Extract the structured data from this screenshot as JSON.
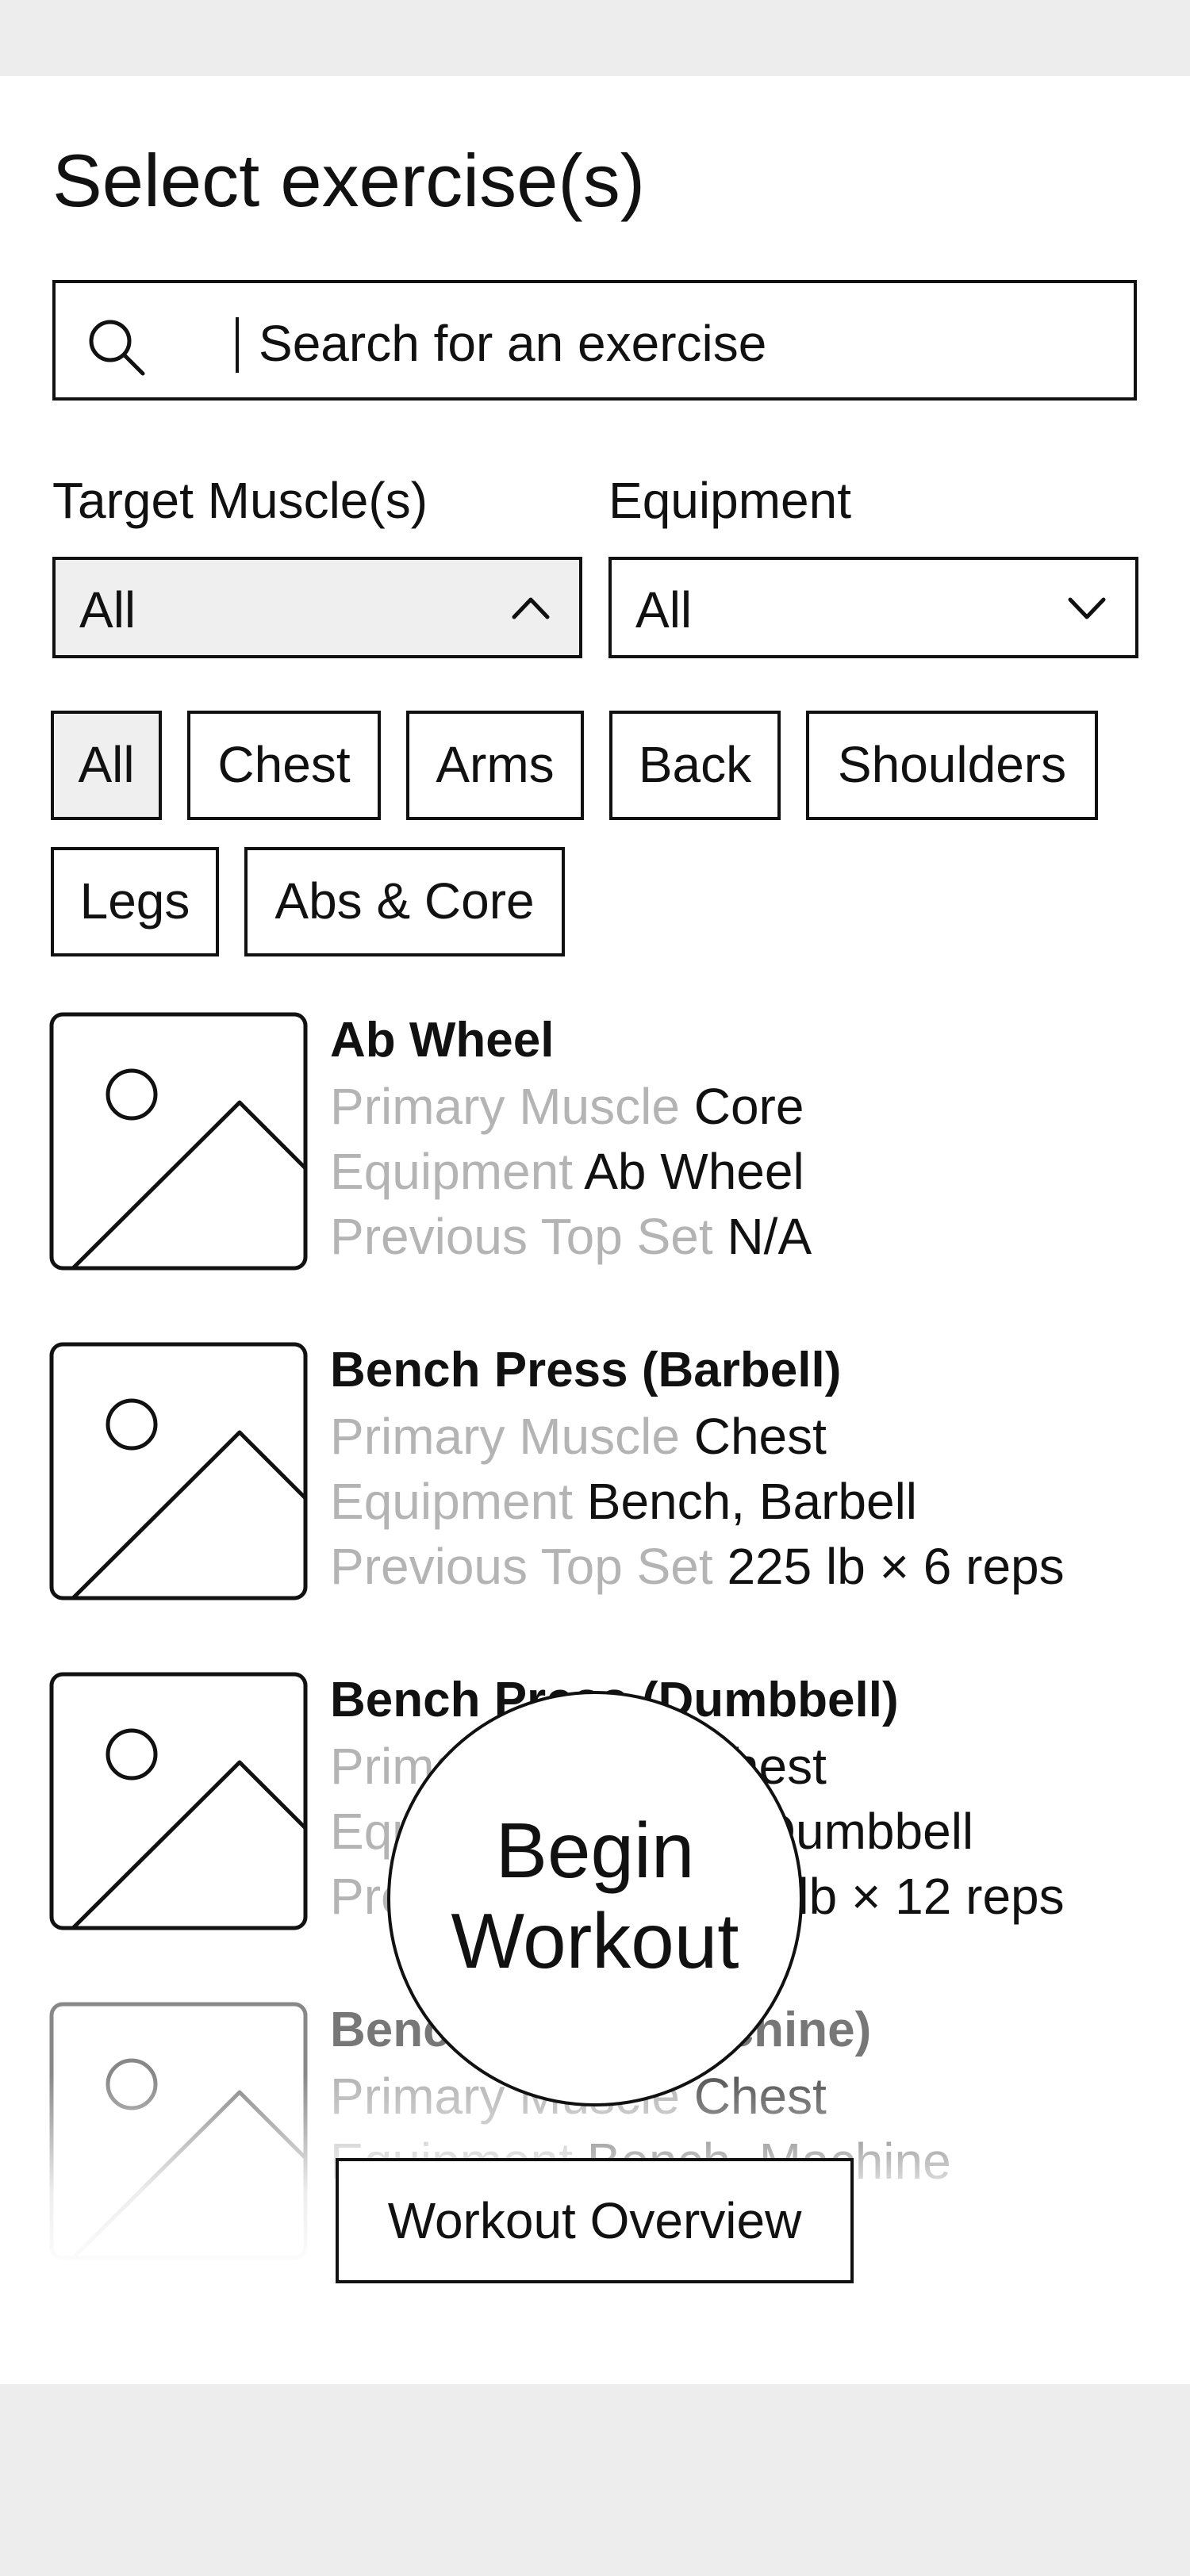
{
  "header": {
    "title": "Select exercise(s)"
  },
  "search": {
    "placeholder": "Search for an exercise"
  },
  "filters": {
    "target_label": "Target Muscle(s)",
    "target_value": "All",
    "equipment_label": "Equipment",
    "equipment_value": "All"
  },
  "chips": [
    "All",
    "Chest",
    "Arms",
    "Back",
    "Shoulders",
    "Legs",
    "Abs & Core"
  ],
  "labels": {
    "primary_muscle": "Primary Muscle",
    "equipment": "Equipment",
    "previous_top_set": "Previous Top Set"
  },
  "exercises": [
    {
      "name": "Ab Wheel",
      "muscle": "Core",
      "equipment": "Ab Wheel",
      "top_set": "N/A"
    },
    {
      "name": "Bench Press (Barbell)",
      "muscle": "Chest",
      "equipment": "Bench, Barbell",
      "top_set": "225 lb × 6 reps"
    },
    {
      "name": "Bench Press (Dumbbell)",
      "muscle": "Chest",
      "equipment": "Bench, Dumbbell",
      "top_set": "75 lb × 12 reps"
    },
    {
      "name": "Bench Press (Machine)",
      "muscle": "Chest",
      "equipment": "Bench, Machine"
    }
  ],
  "actions": {
    "begin_line1": "Begin",
    "begin_line2": "Workout",
    "overview": "Workout Overview"
  },
  "icons": {
    "search": "search-icon",
    "image_placeholder": "image-placeholder-icon",
    "chevron_up": "chevron-up-icon",
    "chevron_down": "chevron-down-icon"
  },
  "colors": {
    "muted_label": "#b4b4b4",
    "active_bg": "#efefef",
    "outer_bg": "#ededed"
  }
}
